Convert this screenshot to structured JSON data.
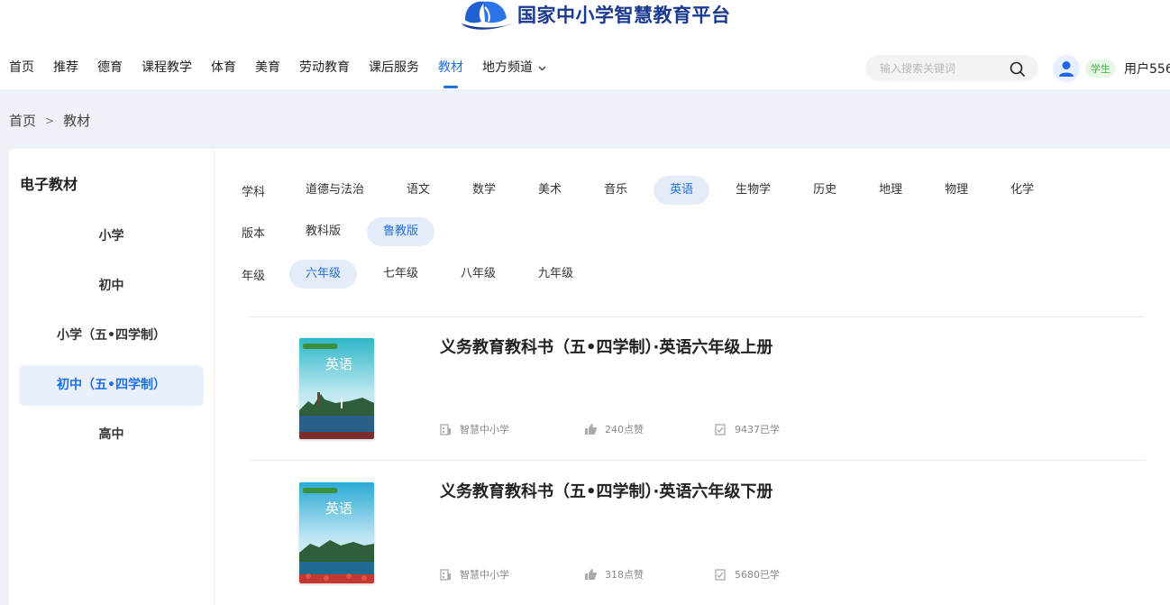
{
  "header": {
    "logo_text": "国家中小学智慧教育平台",
    "nav": [
      {
        "label": "首页",
        "active": false
      },
      {
        "label": "推荐",
        "active": false
      },
      {
        "label": "德育",
        "active": false
      },
      {
        "label": "课程教学",
        "active": false
      },
      {
        "label": "体育",
        "active": false
      },
      {
        "label": "美育",
        "active": false
      },
      {
        "label": "劳动教育",
        "active": false
      },
      {
        "label": "课后服务",
        "active": false
      },
      {
        "label": "教材",
        "active": true
      },
      {
        "label": "地方频道",
        "active": false,
        "dropdown": true
      }
    ],
    "search_placeholder": "输入搜索关键词",
    "user_badge": "学生",
    "username": "用户556"
  },
  "breadcrumb": {
    "home": "首页",
    "sep": ">",
    "current": "教材"
  },
  "sidebar": {
    "title": "电子教材",
    "items": [
      {
        "label": "小学",
        "active": false
      },
      {
        "label": "初中",
        "active": false
      },
      {
        "label": "小学（五•四学制）",
        "active": false
      },
      {
        "label": "初中（五•四学制）",
        "active": true
      },
      {
        "label": "高中",
        "active": false
      }
    ]
  },
  "filters": {
    "subject": {
      "label": "学科",
      "options": [
        "道德与法治",
        "语文",
        "数学",
        "美术",
        "音乐",
        "英语",
        "生物学",
        "历史",
        "地理",
        "物理",
        "化学"
      ],
      "selected": "英语"
    },
    "edition": {
      "label": "版本",
      "options": [
        "教科版",
        "鲁教版"
      ],
      "selected": "鲁教版"
    },
    "grade": {
      "label": "年级",
      "options": [
        "六年级",
        "七年级",
        "八年级",
        "九年级"
      ],
      "selected": "六年级"
    }
  },
  "books": [
    {
      "title": "义务教育教科书（五•四学制）·英语六年级上册",
      "publisher": "智慧中小学",
      "likes": "240点赞",
      "learned": "9437已学",
      "cover_title": "英语"
    },
    {
      "title": "义务教育教科书（五•四学制）·英语六年级下册",
      "publisher": "智慧中小学",
      "likes": "318点赞",
      "learned": "5680已学",
      "cover_title": "英语"
    }
  ],
  "colors": {
    "accent": "#1f6fe0",
    "logo": "#1a3a8f",
    "badge_green": "#43b243"
  }
}
